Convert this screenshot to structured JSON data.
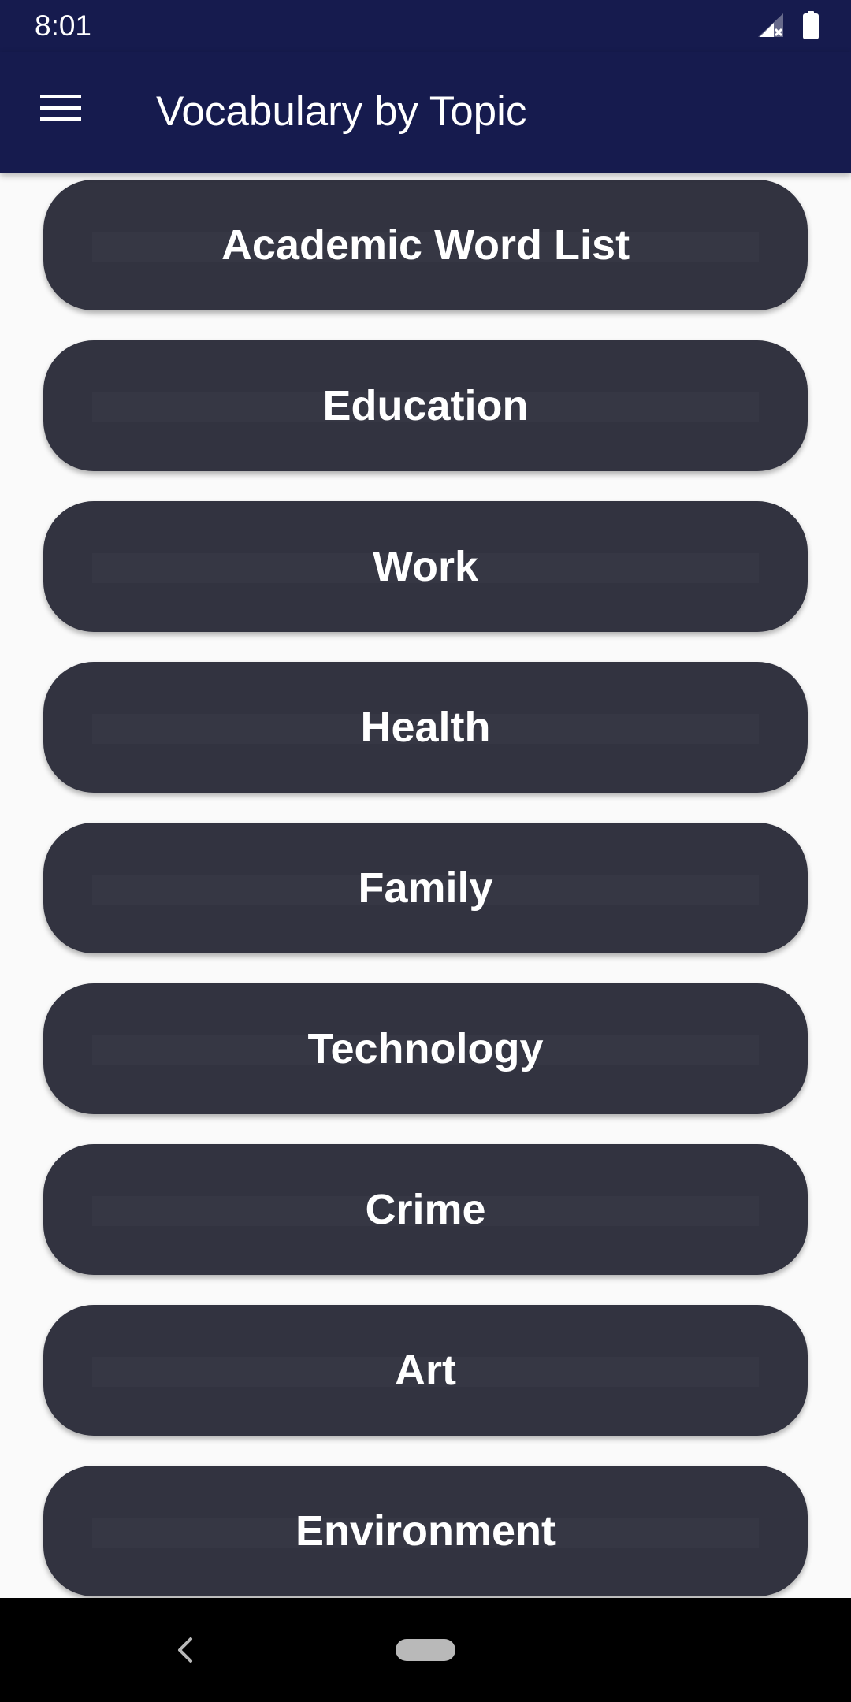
{
  "status_bar": {
    "time": "8:01",
    "icons": [
      "signal-no-data-icon",
      "battery-full-icon"
    ]
  },
  "app_bar": {
    "title": "Vocabulary by Topic",
    "menu_icon": "hamburger-menu-icon"
  },
  "topics": [
    {
      "label": "Academic Word List"
    },
    {
      "label": "Education"
    },
    {
      "label": "Work"
    },
    {
      "label": "Health"
    },
    {
      "label": "Family"
    },
    {
      "label": "Technology"
    },
    {
      "label": "Crime"
    },
    {
      "label": "Art"
    },
    {
      "label": "Environment"
    }
  ],
  "nav_bar": {
    "icons": [
      "back-chevron-icon",
      "home-pill-icon"
    ]
  },
  "colors": {
    "app_bar": "#161b4e",
    "button": "#323340",
    "background": "#fafafa",
    "nav_bar": "#000000"
  }
}
